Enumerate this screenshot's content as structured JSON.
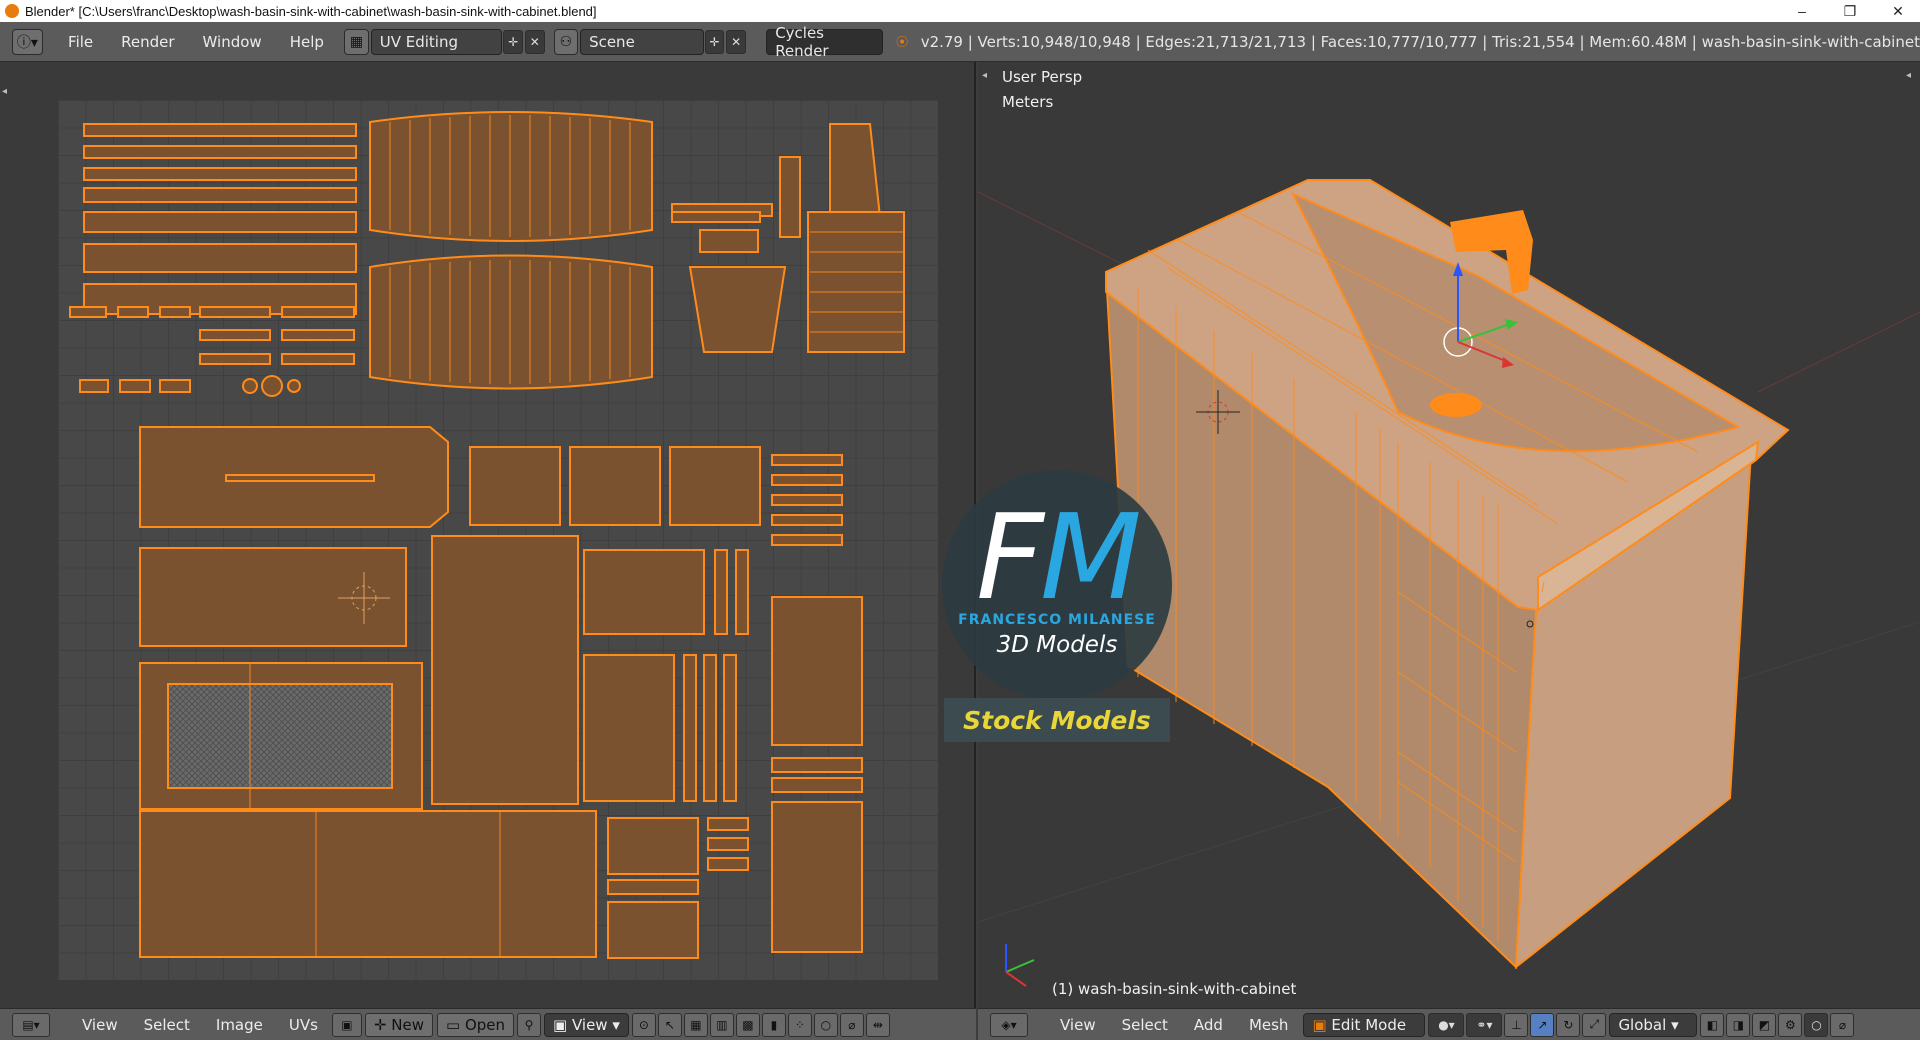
{
  "window": {
    "title": "Blender* [C:\\Users\\franc\\Desktop\\wash-basin-sink-with-cabinet\\wash-basin-sink-with-cabinet.blend]",
    "minimize": "–",
    "maximize": "❐",
    "close": "✕"
  },
  "info_header": {
    "menus": [
      "File",
      "Render",
      "Window",
      "Help"
    ],
    "screen_layout": "UV Editing",
    "scene": "Scene",
    "render_engine": "Cycles Render",
    "stats": "v2.79 | Verts:10,948/10,948 | Edges:21,713/21,713 | Faces:10,777/10,777 | Tris:21,554 | Mem:60.48M | wash-basin-sink-with-cabinet"
  },
  "viewport": {
    "view_name": "User Persp",
    "units": "Meters",
    "object_label": "(1) wash-basin-sink-with-cabinet"
  },
  "uv_header": {
    "menus": [
      "View",
      "Select",
      "Image",
      "UVs"
    ],
    "new_label": "New",
    "open_label": "Open",
    "view_label": "View"
  },
  "view3d_header": {
    "menus": [
      "View",
      "Select",
      "Add",
      "Mesh"
    ],
    "mode": "Edit Mode",
    "orientation": "Global"
  },
  "watermark": {
    "letters_f": "F",
    "letters_m": "M",
    "name": "FRANCESCO MILANESE",
    "subtitle": "3D Models",
    "badge": "Stock Models"
  },
  "colors": {
    "accent_orange": "#ff8c1a",
    "uv_face_fill": "#7a5230",
    "logo_blue": "#2aa7e0",
    "badge_yellow": "#e9d63a"
  }
}
